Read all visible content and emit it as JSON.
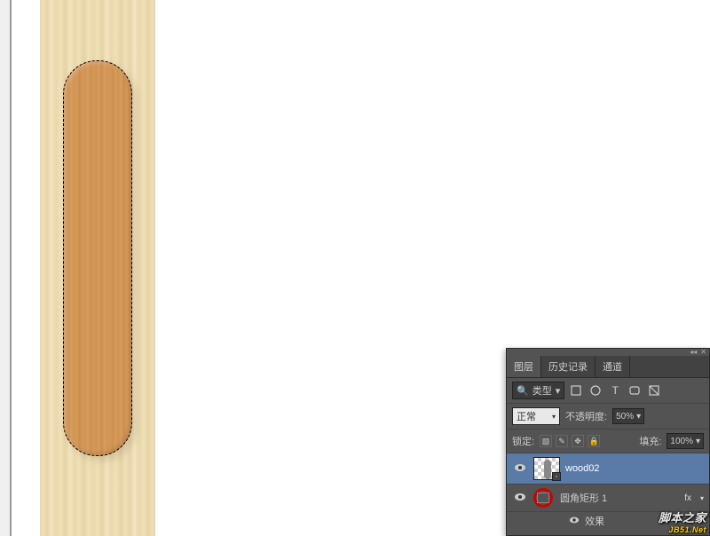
{
  "panel": {
    "tabs": [
      "图层",
      "历史记录",
      "通道"
    ],
    "active_tab": 0,
    "filter_label": "类型",
    "blend_mode": "正常",
    "opacity_label": "不透明度:",
    "opacity_value": "50%",
    "lock_label": "锁定:",
    "fill_label": "填充:",
    "fill_value": "100%"
  },
  "layers": [
    {
      "name": "wood02",
      "selected": true,
      "visible": true
    },
    {
      "name": "圆角矩形 1",
      "selected": false,
      "visible": true,
      "fx": true
    }
  ],
  "effects_label": "效果",
  "fx_label": "fx",
  "watermark": {
    "line1": "脚本之家",
    "line2": "JB51.Net"
  }
}
